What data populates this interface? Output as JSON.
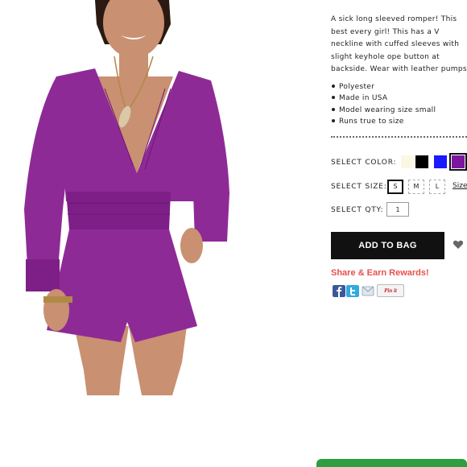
{
  "product": {
    "description": "A sick long sleeved romper! This best every girl! This has a V neckline with cuffed sleeves with slight keyhole ope button at backside. Wear with leather pumps!",
    "features": [
      "Polyester",
      "Made in USA",
      "Model wearing size small",
      "Runs true to size"
    ]
  },
  "options": {
    "color_label": "SELECT COLOR:",
    "colors": [
      {
        "name": "cream",
        "hex": "#fcf7e4",
        "selected": false
      },
      {
        "name": "black",
        "hex": "#000000",
        "selected": false
      },
      {
        "name": "blue",
        "hex": "#1a1aff",
        "selected": false
      },
      {
        "name": "purple",
        "hex": "#7b16a0",
        "selected": true
      }
    ],
    "size_label": "SELECT SIZE:",
    "sizes": [
      "S",
      "M",
      "L"
    ],
    "selected_size": "S",
    "size_chart_label": "Size",
    "qty_label": "SELECT QTY:",
    "qty_value": "1"
  },
  "actions": {
    "add_to_bag": "ADD TO BAG",
    "share_title": "Share & Earn Rewards!",
    "pinit_label": "Pin it"
  },
  "colors": {
    "garment": "#8e2a96",
    "share": "#e8504d",
    "chat": "#2f9e3f"
  }
}
